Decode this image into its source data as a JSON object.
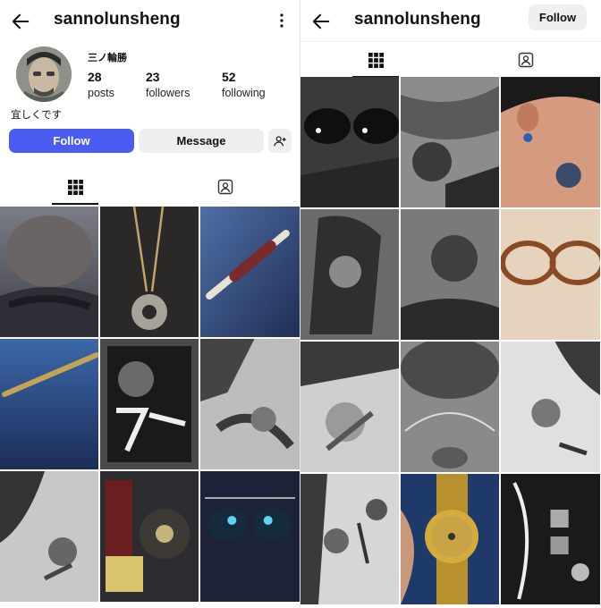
{
  "left": {
    "username": "sannolunsheng",
    "display_name": "三ノ輪勝",
    "stats": [
      {
        "value": "28",
        "label": "posts"
      },
      {
        "value": "23",
        "label": "followers"
      },
      {
        "value": "52",
        "label": "following"
      }
    ],
    "bio": "宜しくです",
    "buttons": {
      "follow": "Follow",
      "message": "Message"
    },
    "icons": {
      "back": "back-arrow-icon",
      "more": "more-vertical-icon",
      "add_user": "add-user-icon",
      "grid": "grid-icon",
      "tagged": "tagged-icon"
    }
  },
  "right": {
    "username": "sannolunsheng",
    "follow_label": "Follow"
  },
  "colors": {
    "follow_button": "#4a5df0",
    "secondary_button": "#efefef"
  }
}
